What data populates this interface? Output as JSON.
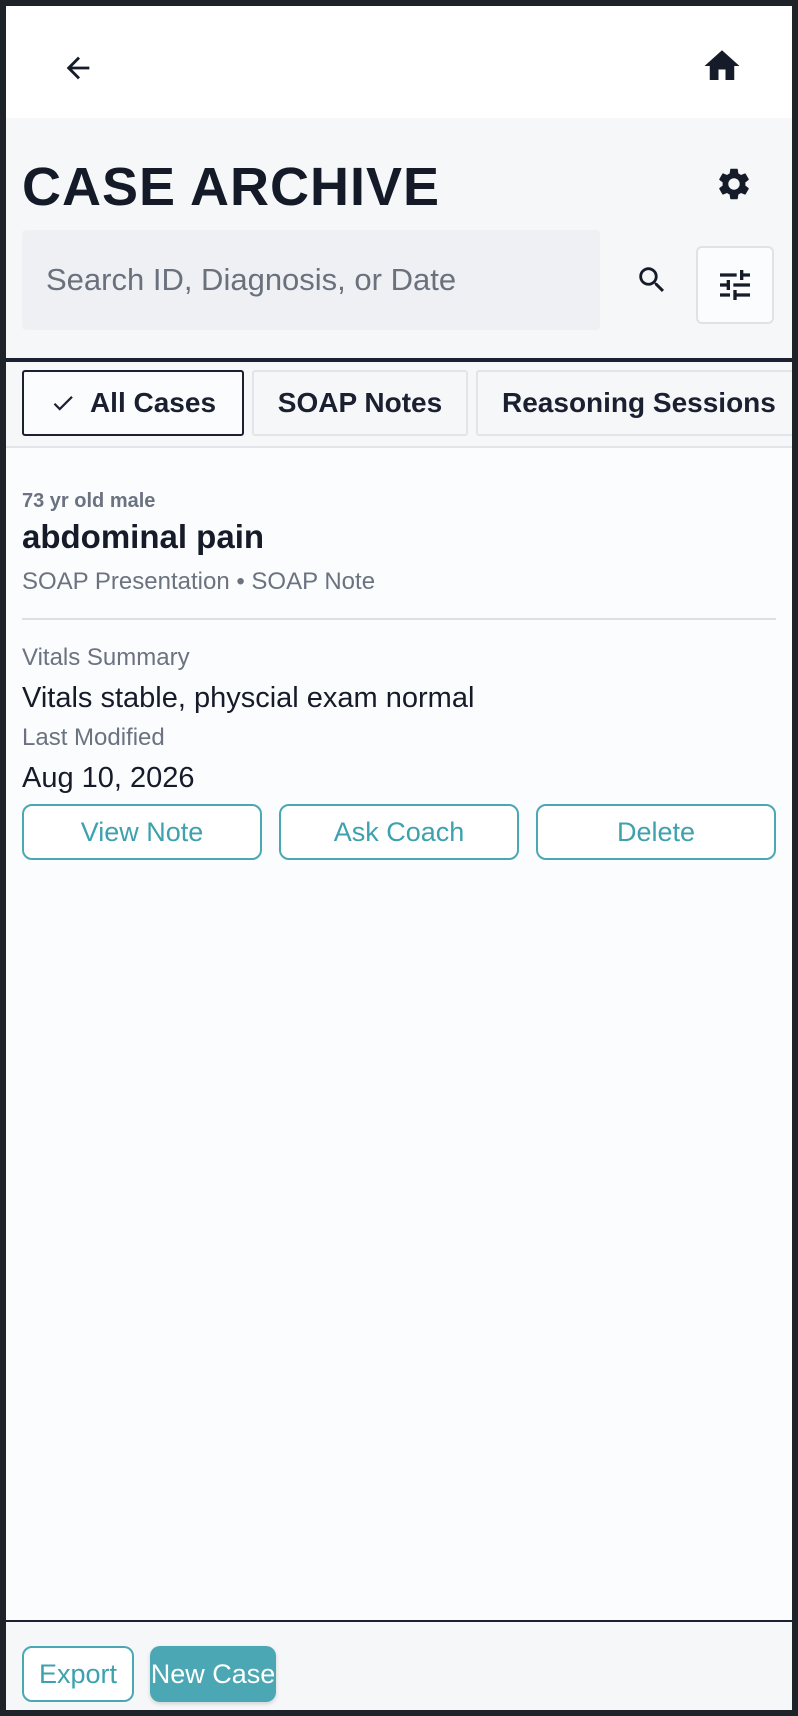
{
  "nav": {
    "back_icon": "arrow-left-icon",
    "home_icon": "home-icon"
  },
  "header": {
    "title": "CASE ARCHIVE",
    "settings_icon": "gear-icon",
    "search_placeholder": "Search ID, Diagnosis, or Date",
    "search_icon": "search-icon",
    "filter_icon": "sliders-icon"
  },
  "tabs": [
    {
      "label": "All Cases",
      "active": true
    },
    {
      "label": "SOAP Notes",
      "active": false
    },
    {
      "label": "Reasoning Sessions",
      "active": false
    }
  ],
  "case": {
    "demographics": "73 yr old male",
    "chief_complaint": "abdominal pain",
    "meta": "SOAP Presentation • SOAP Note",
    "vitals_label": "Vitals Summary",
    "vitals_value": "Vitals stable, physcial exam normal",
    "modified_label": "Last Modified",
    "modified_value": "Aug 10, 2026",
    "actions": {
      "view": "View Note",
      "ask": "Ask Coach",
      "delete": "Delete"
    }
  },
  "footer": {
    "export_label": "Export",
    "new_case_label": "New Case"
  },
  "colors": {
    "accent": "#4aa7b3",
    "ink": "#151b28",
    "muted": "#6b7280",
    "frame": "#1e2329"
  }
}
